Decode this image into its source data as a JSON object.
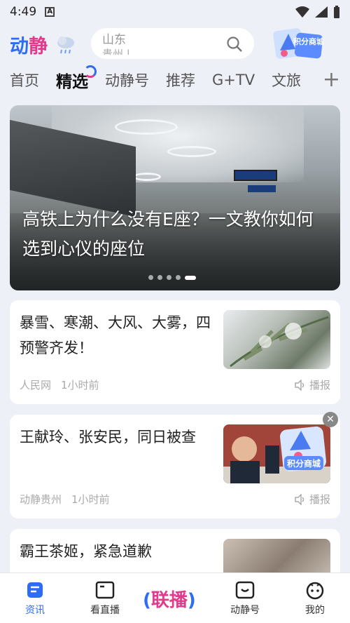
{
  "status_bar": {
    "time": "4:49",
    "app_icon": "A"
  },
  "header": {
    "logo": {
      "part1": "动",
      "part2": "静"
    },
    "search_placeholder": "山东",
    "search_placeholder_line2": "贵州 |",
    "mall_label": "积分商城"
  },
  "tabs": [
    "首页",
    "精选",
    "动静号",
    "推荐",
    "G+TV",
    "文旅"
  ],
  "active_tab": "精选",
  "hero": {
    "title": "高铁上为什么没有E座？一文教你如何选到心仪的座位",
    "slide_index": 5,
    "slide_count": 5
  },
  "feed": [
    {
      "title": "暴雪、寒潮、大风、大雾，四预警齐发！",
      "source": "人民网",
      "time": "1小时前",
      "action": "播报"
    },
    {
      "title": "王献玲、张安民，同日被查",
      "source": "动静贵州",
      "time": "1小时前",
      "action": "播报"
    },
    {
      "title": "霸王茶姬，紧急道歉",
      "source": "",
      "time": "",
      "action": ""
    }
  ],
  "floating_ad": {
    "label": "积分商城"
  },
  "bottom_nav": [
    {
      "label": "资讯",
      "icon": "news-icon",
      "active": true
    },
    {
      "label": "看直播",
      "icon": "live-tv-icon",
      "active": false
    },
    {
      "label": "联播",
      "icon": "lianbo-logo",
      "active": false
    },
    {
      "label": "动静号",
      "icon": "smile-tv-icon",
      "active": false
    },
    {
      "label": "我的",
      "icon": "avatar-icon",
      "active": false
    }
  ],
  "colors": {
    "brand_blue": "#2d6df6",
    "brand_pink": "#e23a8c",
    "background": "#edf0f6"
  }
}
